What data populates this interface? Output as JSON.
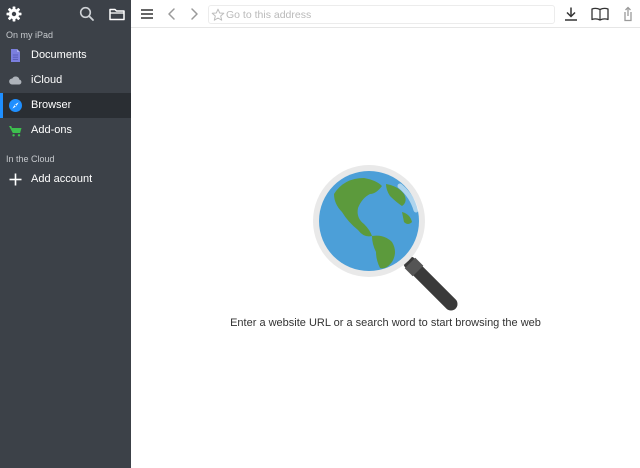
{
  "sidebar": {
    "toolbar": {
      "icons": [
        "gear-icon",
        "search-icon",
        "folder-icon"
      ]
    },
    "sections": [
      {
        "label": "On my iPad",
        "items": [
          {
            "label": "Documents",
            "icon": "document-icon",
            "color": "#7b7fde"
          },
          {
            "label": "iCloud",
            "icon": "cloud-icon",
            "color": "#aeb3ba"
          },
          {
            "label": "Browser",
            "icon": "compass-icon",
            "color": "#1f8fff",
            "active": true
          },
          {
            "label": "Add-ons",
            "icon": "cart-icon",
            "color": "#3dbf4e"
          }
        ]
      },
      {
        "label": "In the Cloud",
        "items": [
          {
            "label": "Add account",
            "icon": "plus-icon"
          }
        ]
      }
    ]
  },
  "browser": {
    "toolbar": {
      "icons": [
        "menu-icon",
        "back-icon",
        "forward-icon",
        "download-icon",
        "bookmarks-icon",
        "share-icon"
      ]
    },
    "address": {
      "placeholder": "Go to this address",
      "value": ""
    },
    "empty_state": {
      "illustration": "globe-magnifier-icon",
      "message": "Enter a website URL or a search word to start browsing the web"
    }
  },
  "colors": {
    "sidebar_bg": "#3c4148",
    "active_item_bg": "#2a2e33",
    "accent": "#1f8fff"
  }
}
